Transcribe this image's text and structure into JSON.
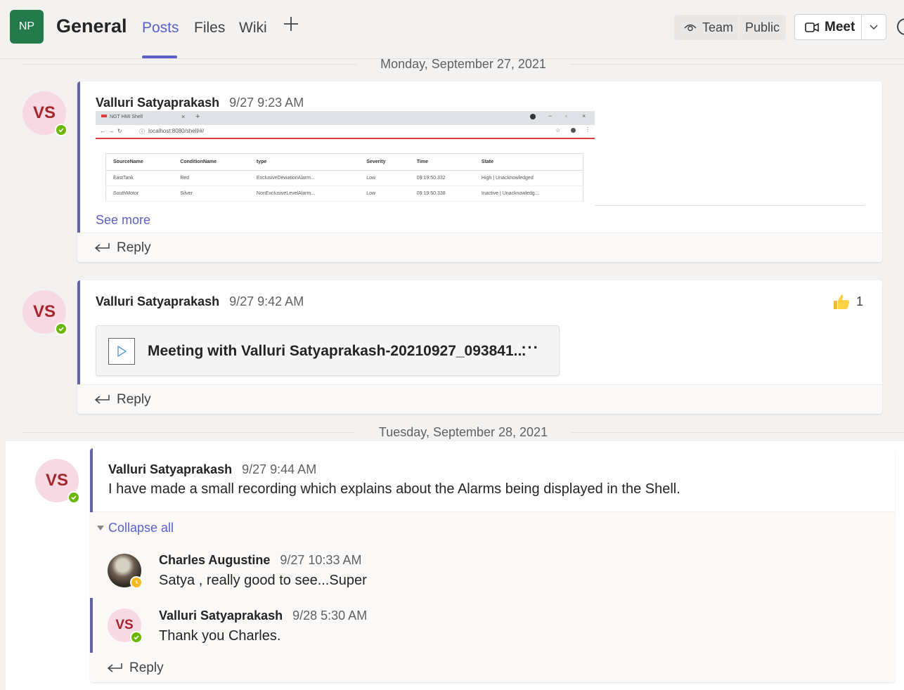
{
  "header": {
    "team_initials": "NP",
    "channel_title": "General",
    "tabs": [
      {
        "label": "Posts",
        "active": true
      },
      {
        "label": "Files",
        "active": false
      },
      {
        "label": "Wiki",
        "active": false
      }
    ],
    "add_tab_icon": "plus-icon",
    "team_label": "Team",
    "visibility_label": "Public",
    "meet_label": "Meet"
  },
  "date_separators": [
    "Monday, September 27, 2021",
    "Tuesday, September 28, 2021"
  ],
  "posts": [
    {
      "avatar_initials": "VS",
      "author": "Valluri Satyaprakash",
      "time": "9/27 9:23 AM",
      "see_more": "See more",
      "reply": "Reply",
      "screenshot": {
        "tab_title": "NGT HMI Shell",
        "address": "localhost:8080/shell/#/",
        "columns": [
          "SourceName",
          "ConditionName",
          "type",
          "Severity",
          "Time",
          "State"
        ],
        "rows": [
          [
            "EastTank",
            "Red",
            "ExclusiveDeviationAlarm...",
            "Low",
            "09:19:50.332",
            "High | Unacknowledged"
          ],
          [
            "SouthMotor",
            "Silver",
            "NonExclusiveLevelAlarm...",
            "Low",
            "09:19:50.338",
            "Inactive | Unacknowledg..."
          ]
        ]
      }
    },
    {
      "avatar_initials": "VS",
      "author": "Valluri Satyaprakash",
      "time": "9/27 9:42 AM",
      "reaction_count": "1",
      "file_name": "Meeting with Valluri Satyaprakash-20210927_093841...",
      "file_more": "···",
      "reply": "Reply"
    },
    {
      "avatar_initials": "VS",
      "author": "Valluri Satyaprakash",
      "time": "9/27 9:44 AM",
      "text": "I have made a small recording which explains about the Alarms being displayed in the Shell.",
      "collapse_label": "Collapse all",
      "replies": [
        {
          "author": "Charles Augustine",
          "time": "9/27 10:33 AM",
          "text": "Satya , really good to see...Super",
          "presence": "away"
        },
        {
          "author": "Valluri Satyaprakash",
          "time": "9/28 5:30 AM",
          "text": "Thank you Charles.",
          "avatar_initials": "VS",
          "presence": "available"
        }
      ],
      "reply": "Reply"
    }
  ],
  "colors": {
    "accent": "#5b5fc7",
    "team_avatar": "#237b4b",
    "presence_available": "#6bb700",
    "presence_away": "#f8b920",
    "avatar_bg": "#f7d9e3",
    "avatar_text": "#a4262c"
  }
}
